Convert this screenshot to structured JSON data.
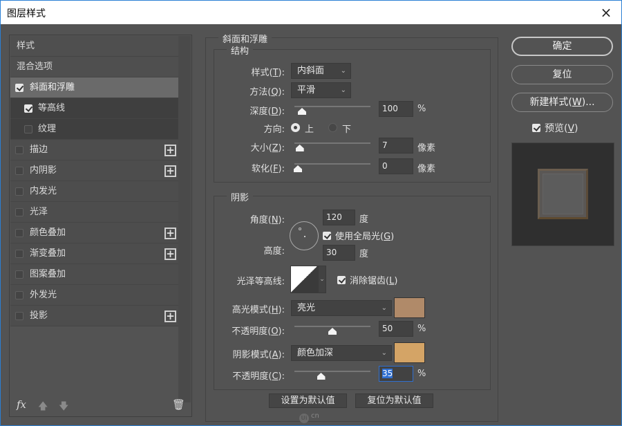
{
  "window": {
    "title": "图层样式",
    "close_icon": "×"
  },
  "sidebar": {
    "header": "样式",
    "blend_options": "混合选项",
    "items": [
      {
        "label": "斜面和浮雕",
        "checked": true,
        "selected": true,
        "sub": false,
        "has_plus": false
      },
      {
        "label": "等高线",
        "checked": true,
        "selected": false,
        "sub": true,
        "has_plus": false
      },
      {
        "label": "纹理",
        "checked": false,
        "selected": false,
        "sub": true,
        "has_plus": false
      },
      {
        "label": "描边",
        "checked": false,
        "selected": false,
        "sub": false,
        "has_plus": true
      },
      {
        "label": "内阴影",
        "checked": false,
        "selected": false,
        "sub": false,
        "has_plus": true
      },
      {
        "label": "内发光",
        "checked": false,
        "selected": false,
        "sub": false,
        "has_plus": false
      },
      {
        "label": "光泽",
        "checked": false,
        "selected": false,
        "sub": false,
        "has_plus": false
      },
      {
        "label": "颜色叠加",
        "checked": false,
        "selected": false,
        "sub": false,
        "has_plus": true
      },
      {
        "label": "渐变叠加",
        "checked": false,
        "selected": false,
        "sub": false,
        "has_plus": true
      },
      {
        "label": "图案叠加",
        "checked": false,
        "selected": false,
        "sub": false,
        "has_plus": false
      },
      {
        "label": "外发光",
        "checked": false,
        "selected": false,
        "sub": false,
        "has_plus": false
      },
      {
        "label": "投影",
        "checked": false,
        "selected": false,
        "sub": false,
        "has_plus": true
      }
    ],
    "plus_glyph": "+",
    "footer": {
      "fx_label": "fx",
      "up_icon": "🡅",
      "down_icon": "🡇",
      "trash_icon": "🗑"
    }
  },
  "bevel": {
    "group_title": "斜面和浮雕",
    "structure": {
      "title": "结构",
      "style_label": "样式(",
      "style_key": "T",
      "style_suffix": "):",
      "style_value": "内斜面",
      "technique_label": "方法(",
      "technique_key": "Q",
      "technique_suffix": "):",
      "technique_value": "平滑",
      "depth_label": "深度(",
      "depth_key": "D",
      "depth_suffix": "):",
      "depth_value": "100",
      "depth_unit": "%",
      "depth_slider_fraction": 0.1,
      "direction_label": "方向:",
      "direction_up": "上",
      "direction_down": "下",
      "direction_selected": "up",
      "size_label": "大小(",
      "size_key": "Z",
      "size_suffix": "):",
      "size_value": "7",
      "size_unit": "像素",
      "size_slider_fraction": 0.07,
      "soften_label": "软化(",
      "soften_key": "F",
      "soften_suffix": "):",
      "soften_value": "0",
      "soften_unit": "像素",
      "soften_slider_fraction": 0.0
    },
    "shading": {
      "title": "阴影",
      "angle_label": "角度(",
      "angle_key": "N",
      "angle_suffix": "):",
      "angle_value": "120",
      "angle_unit": "度",
      "global_light_label": "使用全局光(",
      "global_light_key": "G",
      "global_light_suffix": ")",
      "global_light_checked": true,
      "altitude_label": "高度:",
      "altitude_value": "30",
      "altitude_unit": "度",
      "gloss_contour_label": "光泽等高线:",
      "antialias_label": "消除锯齿(",
      "antialias_key": "L",
      "antialias_suffix": ")",
      "antialias_checked": true,
      "highlight_mode_label": "高光模式(",
      "highlight_mode_key": "H",
      "highlight_mode_suffix": "):",
      "highlight_mode_value": "亮光",
      "highlight_color": "#b08a69",
      "highlight_opacity_label": "不透明度(",
      "highlight_opacity_key": "O",
      "highlight_opacity_suffix": "):",
      "highlight_opacity_value": "50",
      "highlight_opacity_unit": "%",
      "highlight_opacity_fraction": 0.5,
      "shadow_mode_label": "阴影模式(",
      "shadow_mode_key": "A",
      "shadow_mode_suffix": "):",
      "shadow_mode_value": "颜色加深",
      "shadow_color": "#d4a466",
      "shadow_opacity_label": "不透明度(",
      "shadow_opacity_key": "C",
      "shadow_opacity_suffix": "):",
      "shadow_opacity_value": "35",
      "shadow_opacity_unit": "%",
      "shadow_opacity_fraction": 0.35
    },
    "make_default": "设置为默认值",
    "reset_default": "复位为默认值"
  },
  "actions": {
    "ok": "确定",
    "reset": "复位",
    "new_style_prefix": "新建样式(",
    "new_style_key": "W",
    "new_style_suffix": ")...",
    "preview_prefix": "预览(",
    "preview_key": "V",
    "preview_suffix": ")",
    "preview_checked": true
  },
  "watermark": {
    "logo": "Ui",
    "text": "cn"
  }
}
